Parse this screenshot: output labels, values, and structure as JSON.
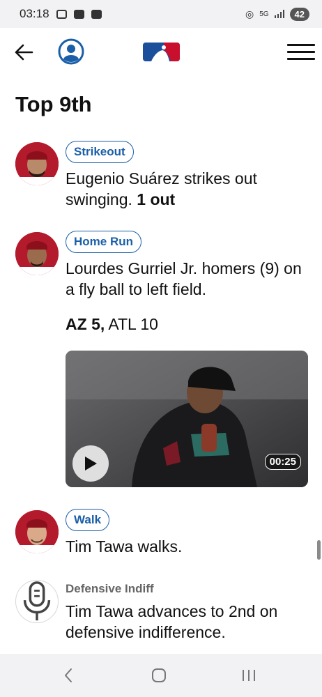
{
  "status_bar": {
    "time": "03:18",
    "network": "5G",
    "battery": "42"
  },
  "app_bar": {
    "brand_colors": {
      "blue": "#1b4f9c",
      "red": "#c8102e"
    }
  },
  "inning_title": "Top 9th",
  "plays": [
    {
      "tag": "Strikeout",
      "description": "Eugenio Suárez strikes out swinging.",
      "outs": "1 out"
    },
    {
      "tag": "Home Run",
      "description": "Lourdes Gurriel Jr. homers (9) on a fly ball to left field.",
      "score": {
        "away_team": "AZ",
        "away_runs": "5,",
        "home_team": "ATL",
        "home_runs": "10"
      },
      "video": {
        "duration": "00:25"
      }
    },
    {
      "tag": "Walk",
      "description": "Tim Tawa walks."
    },
    {
      "tag": "Defensive Indiff",
      "description": "Tim Tawa advances to 2nd on defensive indifference."
    }
  ],
  "icons": {
    "back": "arrow-left-icon",
    "profile": "person-circle-icon",
    "menu": "hamburger-menu-icon",
    "play": "play-icon",
    "mic": "microphone-icon"
  }
}
